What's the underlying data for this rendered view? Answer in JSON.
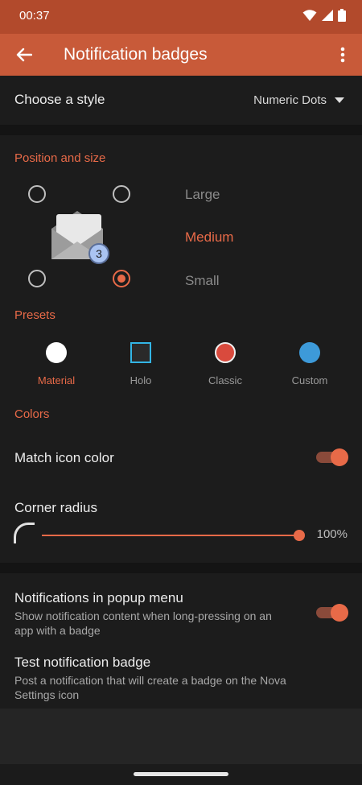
{
  "status_bar": {
    "time": "00:37"
  },
  "app_bar": {
    "title": "Notification badges"
  },
  "style_row": {
    "label": "Choose a style",
    "value": "Numeric Dots"
  },
  "position": {
    "header": "Position and size",
    "sizes": [
      "Large",
      "Medium",
      "Small"
    ],
    "selected_size": "Medium",
    "badge_count": "3"
  },
  "presets": {
    "header": "Presets",
    "items": [
      {
        "label": "Material",
        "color": "#ffffff"
      },
      {
        "label": "Holo",
        "color": "#33b5e5"
      },
      {
        "label": "Classic",
        "color": "#d94a3d"
      },
      {
        "label": "Custom",
        "color": "#3d9ad9"
      }
    ],
    "selected": "Material"
  },
  "colors": {
    "header": "Colors",
    "match_icon_color": {
      "label": "Match icon color",
      "enabled": true
    },
    "corner_radius": {
      "label": "Corner radius",
      "value": "100%",
      "level": 1.0
    }
  },
  "popup": {
    "title": "Notifications in popup menu",
    "summary": "Show notification content when long-pressing on an app with a badge",
    "enabled": true
  },
  "test": {
    "title": "Test notification badge",
    "summary": "Post a notification that will create a badge on the Nova Settings icon"
  },
  "theme": {
    "accent": "#e86a48",
    "app_bar": "#c85a39",
    "status_bar": "#b24a2c"
  }
}
